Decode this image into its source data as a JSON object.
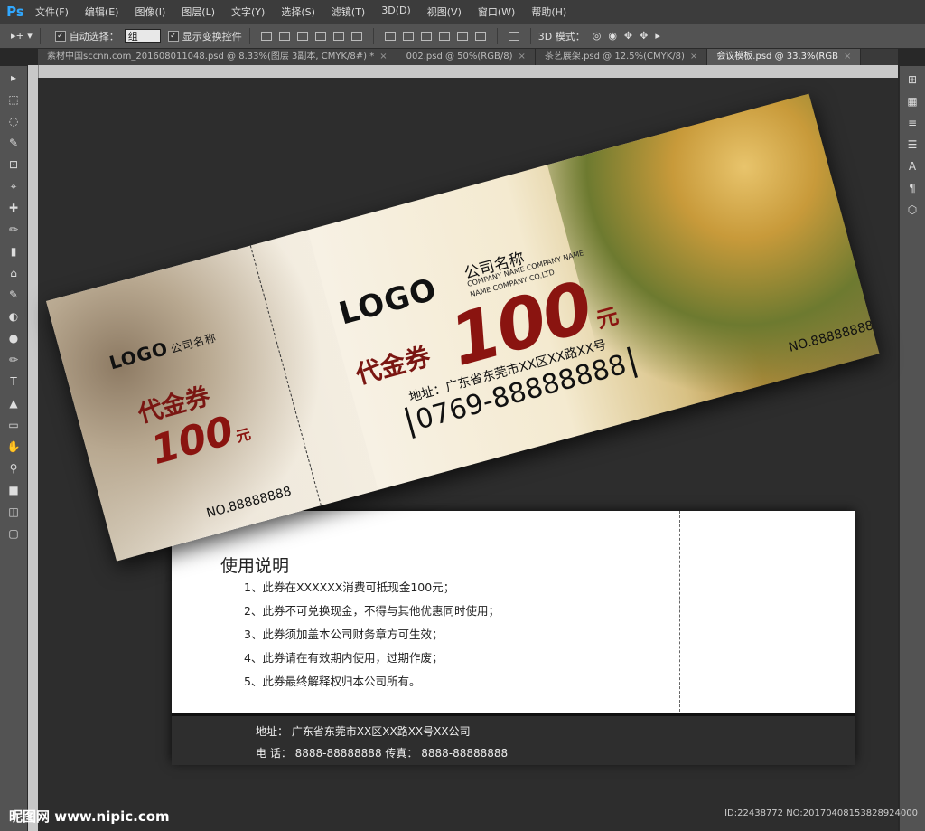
{
  "app": {
    "logo": "Ps"
  },
  "menu": [
    "文件(F)",
    "编辑(E)",
    "图像(I)",
    "图层(L)",
    "文字(Y)",
    "选择(S)",
    "滤镜(T)",
    "3D(D)",
    "视图(V)",
    "窗口(W)",
    "帮助(H)"
  ],
  "options": {
    "auto_select_label": "自动选择：",
    "auto_select_value": "组",
    "show_transform_label": "显示变换控件",
    "mode3d_label": "3D 模式："
  },
  "tabs": [
    {
      "label": "素材中国sccnn.com_20160801104​8.psd @ 8.33%(图层 3副本, CMYK/8#) *",
      "active": false
    },
    {
      "label": "002.psd @ 50%(RGB/8)",
      "active": false
    },
    {
      "label": "茶艺展架.psd @ 12.5%(CMYK/8)",
      "active": false
    },
    {
      "label": "会议模板.psd @ 33.3%(RGB",
      "active": true
    }
  ],
  "tools": [
    "▸",
    "⬚",
    "◌",
    "✎",
    "⊡",
    "⌖",
    "✚",
    "✏",
    "▮",
    "⌂",
    "✎",
    "◐",
    "●",
    "✏",
    "T",
    "▲",
    "▭",
    "✋",
    "⚲",
    "■",
    "◫",
    "▢"
  ],
  "right_icons": [
    "⊞",
    "▦",
    "≡",
    "☰",
    "A",
    "¶",
    "⬡"
  ],
  "front_card": {
    "stub": {
      "logo": "LOGO",
      "company": "公司名称",
      "title": "代金券",
      "amount": "100",
      "unit": "元",
      "no": "NO.88888888"
    },
    "main": {
      "logo": "LOGO",
      "company": "公司名称",
      "en_line1": "COMPANY NAME COMPANY NAME",
      "en_line2": "NAME COMPANY CO.LTD",
      "title": "代金券",
      "amount": "100",
      "unit": "元",
      "address": "地址：广东省东莞市XX区XX路XX号",
      "phone": "0769-88888888",
      "no": "NO.88888888"
    }
  },
  "back_card": {
    "title": "使用说明",
    "rules": [
      "1、此券在XXXXXX消费可抵现金100元；",
      "2、此券不可兑换现金，不得与其他优惠同时使用；",
      "3、此券须加盖本公司财务章方可生效；",
      "4、此券请在有效期内使用，过期作废；",
      "5、此券最终解释权归本公司所有。"
    ],
    "footer_address": "地址： 广东省东莞市XX区XX路XX号XX公司",
    "footer_phone": "电 话： 8888-88888888  传真： 8888-88888888"
  },
  "watermark": "昵图网 www.nipic.com",
  "id_text": "ID:22438772 NO:20170408153828924000"
}
